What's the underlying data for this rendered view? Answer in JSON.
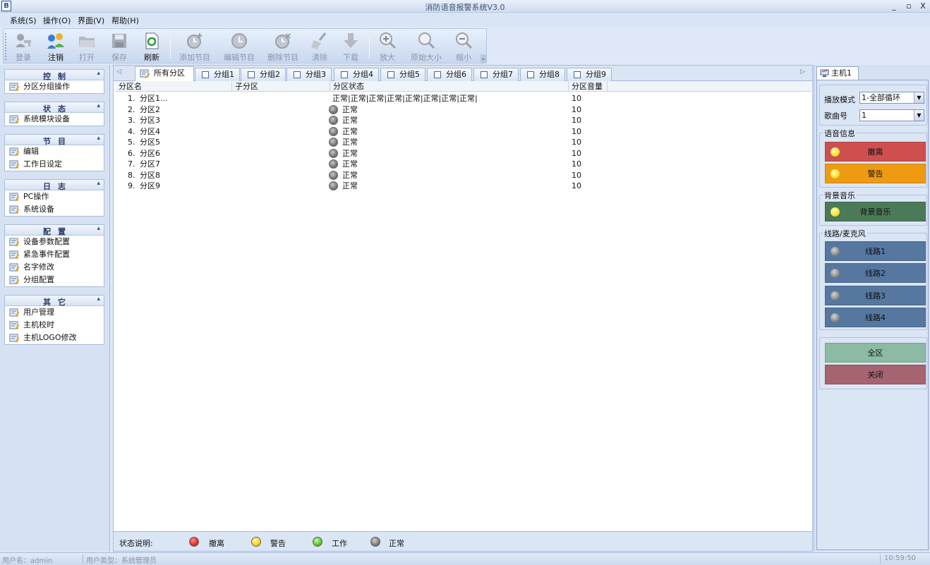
{
  "window": {
    "title": "消防语音报警系统V3.0",
    "minimize": "_",
    "maximize": "▫",
    "close": "X"
  },
  "menu": {
    "items": [
      "系统(S)",
      "操作(O)",
      "界面(V)",
      "帮助(H)"
    ]
  },
  "toolbar": {
    "buttons": [
      {
        "label": "登录",
        "icon": "login-icon",
        "enabled": false
      },
      {
        "label": "注销",
        "icon": "logout-icon",
        "enabled": true
      },
      {
        "label": "打开",
        "icon": "folder-icon",
        "enabled": false
      },
      {
        "label": "保存",
        "icon": "save-icon",
        "enabled": false
      },
      {
        "label": "刷新",
        "icon": "refresh-icon",
        "enabled": true
      },
      {
        "label": "添加节目",
        "icon": "add-program-icon",
        "enabled": false
      },
      {
        "label": "编辑节目",
        "icon": "edit-program-icon",
        "enabled": false
      },
      {
        "label": "删除节目",
        "icon": "delete-program-icon",
        "enabled": false
      },
      {
        "label": "清除",
        "icon": "broom-icon",
        "enabled": false
      },
      {
        "label": "下载",
        "icon": "download-icon",
        "enabled": false
      },
      {
        "label": "放大",
        "icon": "zoom-in-icon",
        "enabled": false
      },
      {
        "label": "原始大小",
        "icon": "zoom-reset-icon",
        "enabled": false
      },
      {
        "label": "缩小",
        "icon": "zoom-out-icon",
        "enabled": false
      }
    ]
  },
  "sidebar": {
    "groups": [
      {
        "title": "控制",
        "items": [
          "分区分组操作"
        ]
      },
      {
        "title": "状态",
        "items": [
          "系统模块设备"
        ]
      },
      {
        "title": "节目",
        "items": [
          "编辑",
          "工作日设定"
        ]
      },
      {
        "title": "日志",
        "items": [
          "PC操作",
          "系统设备"
        ]
      },
      {
        "title": "配置",
        "items": [
          "设备参数配置",
          "紧急事件配置",
          "名字修改",
          "分组配置"
        ]
      },
      {
        "title": "其它",
        "items": [
          "用户管理",
          "主机校时",
          "主机LOGO修改"
        ]
      }
    ]
  },
  "tabs": [
    "所有分区",
    "分组1",
    "分组2",
    "分组3",
    "分组4",
    "分组5",
    "分组6",
    "分组7",
    "分组8",
    "分组9"
  ],
  "table": {
    "columns": [
      "分区名",
      "子分区",
      "分区状态",
      "分区音量"
    ],
    "rows": [
      {
        "index": "1.",
        "name": "分区1...",
        "status": "正常|正常|正常|正常|正常|正常|正常|正常|",
        "volume": "10",
        "dot": false
      },
      {
        "index": "2.",
        "name": "分区2",
        "status": "正常",
        "volume": "10",
        "dot": true
      },
      {
        "index": "3.",
        "name": "分区3",
        "status": "正常",
        "volume": "10",
        "dot": true
      },
      {
        "index": "4.",
        "name": "分区4",
        "status": "正常",
        "volume": "10",
        "dot": true
      },
      {
        "index": "5.",
        "name": "分区5",
        "status": "正常",
        "volume": "10",
        "dot": true
      },
      {
        "index": "6.",
        "name": "分区6",
        "status": "正常",
        "volume": "10",
        "dot": true
      },
      {
        "index": "7.",
        "name": "分区7",
        "status": "正常",
        "volume": "10",
        "dot": true
      },
      {
        "index": "8.",
        "name": "分区8",
        "status": "正常",
        "volume": "10",
        "dot": true
      },
      {
        "index": "9.",
        "name": "分区9",
        "status": "正常",
        "volume": "10",
        "dot": true
      }
    ]
  },
  "legend": {
    "title": "状态说明:",
    "items": [
      {
        "label": "撤离",
        "color": "#e02a25"
      },
      {
        "label": "警告",
        "color": "#f5d21a"
      },
      {
        "label": "工作",
        "color": "#4ecb26"
      },
      {
        "label": "正常",
        "color": "#7a7a7a"
      }
    ]
  },
  "host_panel": {
    "tab": "主机1",
    "play_mode_label": "播放模式",
    "play_mode_value": "1-全部循环",
    "song_label": "歌曲号",
    "song_value": "1",
    "voice_section": "语音信息",
    "voice_buttons": [
      {
        "label": "撤离",
        "color": "#cf4f4f",
        "led": "#f7e22a"
      },
      {
        "label": "警告",
        "color": "#ee9a12",
        "led": "#f7e22a"
      }
    ],
    "bg_section": "背景音乐",
    "bg_button": {
      "label": "背景音乐",
      "color": "#4a7a57",
      "led": "#f7e22a"
    },
    "line_section": "线路/麦克风",
    "line_buttons": [
      {
        "label": "线路1",
        "color": "#5577a0",
        "led": "#8a8a8a"
      },
      {
        "label": "线路2",
        "color": "#5577a0",
        "led": "#8a8a8a"
      },
      {
        "label": "线路3",
        "color": "#5577a0",
        "led": "#8a8a8a"
      },
      {
        "label": "线路4",
        "color": "#5577a0",
        "led": "#8a8a8a"
      }
    ],
    "all_zone_button": {
      "label": "全区",
      "color": "#8cbaa2"
    },
    "close_button": {
      "label": "关闭",
      "color": "#a56470"
    }
  },
  "statusbar": {
    "user": "用户名：admin",
    "user_type": "用户类型：系统管理员",
    "time": "10:59:50"
  }
}
